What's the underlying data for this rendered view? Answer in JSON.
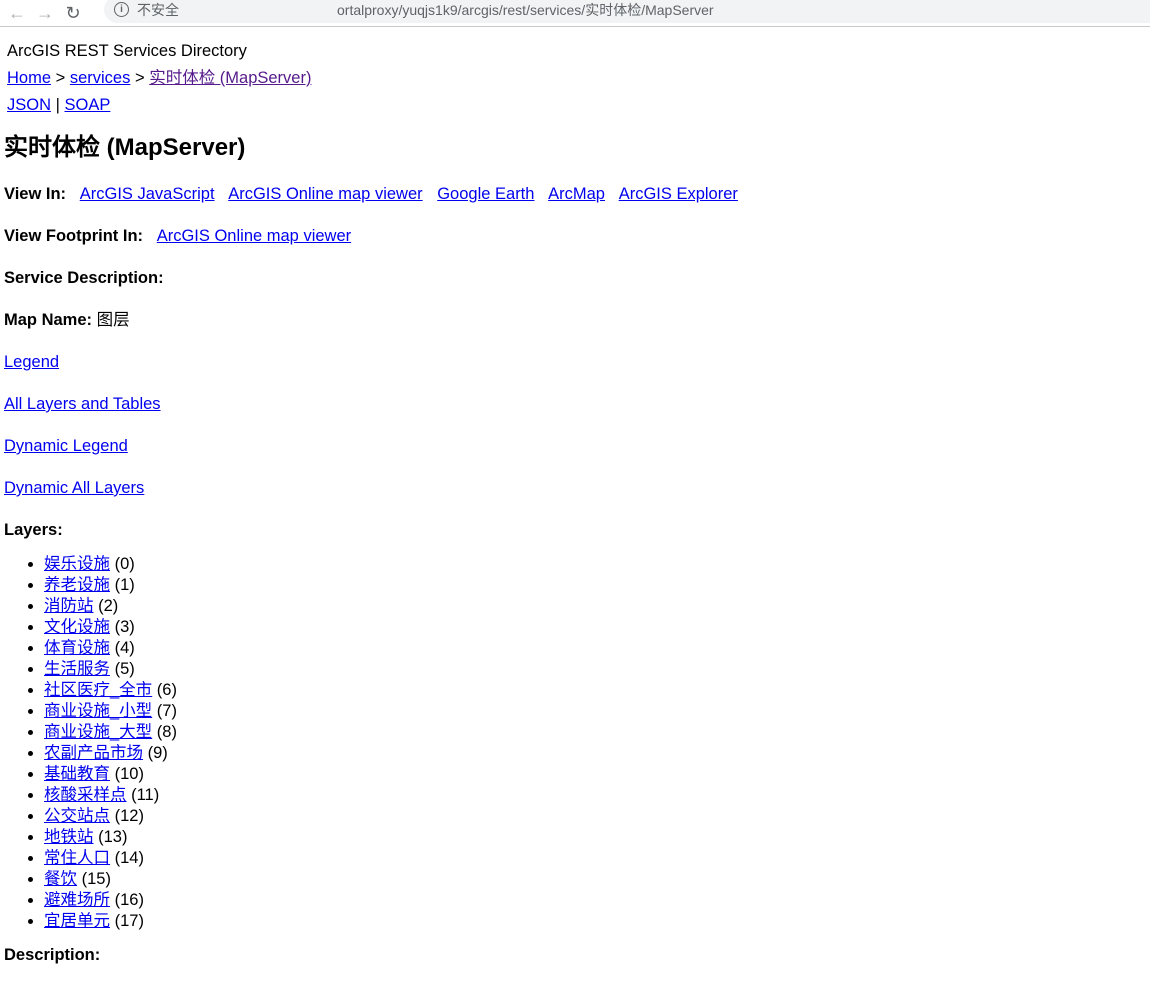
{
  "browser": {
    "security_text": "不安全",
    "url": "ortalproxy/yuqjs1k9/arcgis/rest/services/实时体检/MapServer"
  },
  "header": {
    "directory_title": "ArcGIS REST Services Directory",
    "breadcrumb": {
      "home": "Home",
      "sep1": ">",
      "services": "services",
      "sep2": ">",
      "current": "实时体检 (MapServer)"
    },
    "formats": {
      "json": "JSON",
      "sep": "|",
      "soap": "SOAP"
    }
  },
  "main": {
    "title": "实时体检 (MapServer)",
    "view_in": {
      "label": "View In:",
      "links": [
        "ArcGIS JavaScript",
        "ArcGIS Online map viewer",
        "Google Earth",
        "ArcMap",
        "ArcGIS Explorer"
      ]
    },
    "view_footprint": {
      "label": "View Footprint In:",
      "link": "ArcGIS Online map viewer"
    },
    "service_description": {
      "label": "Service Description:"
    },
    "map_name": {
      "label": "Map Name:",
      "value": "图层"
    },
    "links": {
      "legend": "Legend",
      "all_layers": "All Layers and Tables",
      "dynamic_legend": "Dynamic Legend",
      "dynamic_all_layers": "Dynamic All Layers"
    },
    "layers": {
      "label": "Layers:",
      "items": [
        {
          "name": "娱乐设施",
          "id": "(0)"
        },
        {
          "name": "养老设施",
          "id": "(1)"
        },
        {
          "name": "消防站",
          "id": "(2)"
        },
        {
          "name": "文化设施",
          "id": "(3)"
        },
        {
          "name": "体育设施",
          "id": "(4)"
        },
        {
          "name": "生活服务",
          "id": "(5)"
        },
        {
          "name": "社区医疗_全市",
          "id": "(6)"
        },
        {
          "name": "商业设施_小型",
          "id": "(7)"
        },
        {
          "name": "商业设施_大型",
          "id": "(8)"
        },
        {
          "name": "农副产品市场",
          "id": "(9)"
        },
        {
          "name": "基础教育",
          "id": "(10)"
        },
        {
          "name": "核酸采样点",
          "id": "(11)"
        },
        {
          "name": "公交站点",
          "id": "(12)"
        },
        {
          "name": "地铁站",
          "id": "(13)"
        },
        {
          "name": "常住人口",
          "id": "(14)"
        },
        {
          "name": "餐饮",
          "id": "(15)"
        },
        {
          "name": "避难场所",
          "id": "(16)"
        },
        {
          "name": "宜居单元",
          "id": "(17)"
        }
      ]
    },
    "description": {
      "label": "Description:"
    }
  }
}
